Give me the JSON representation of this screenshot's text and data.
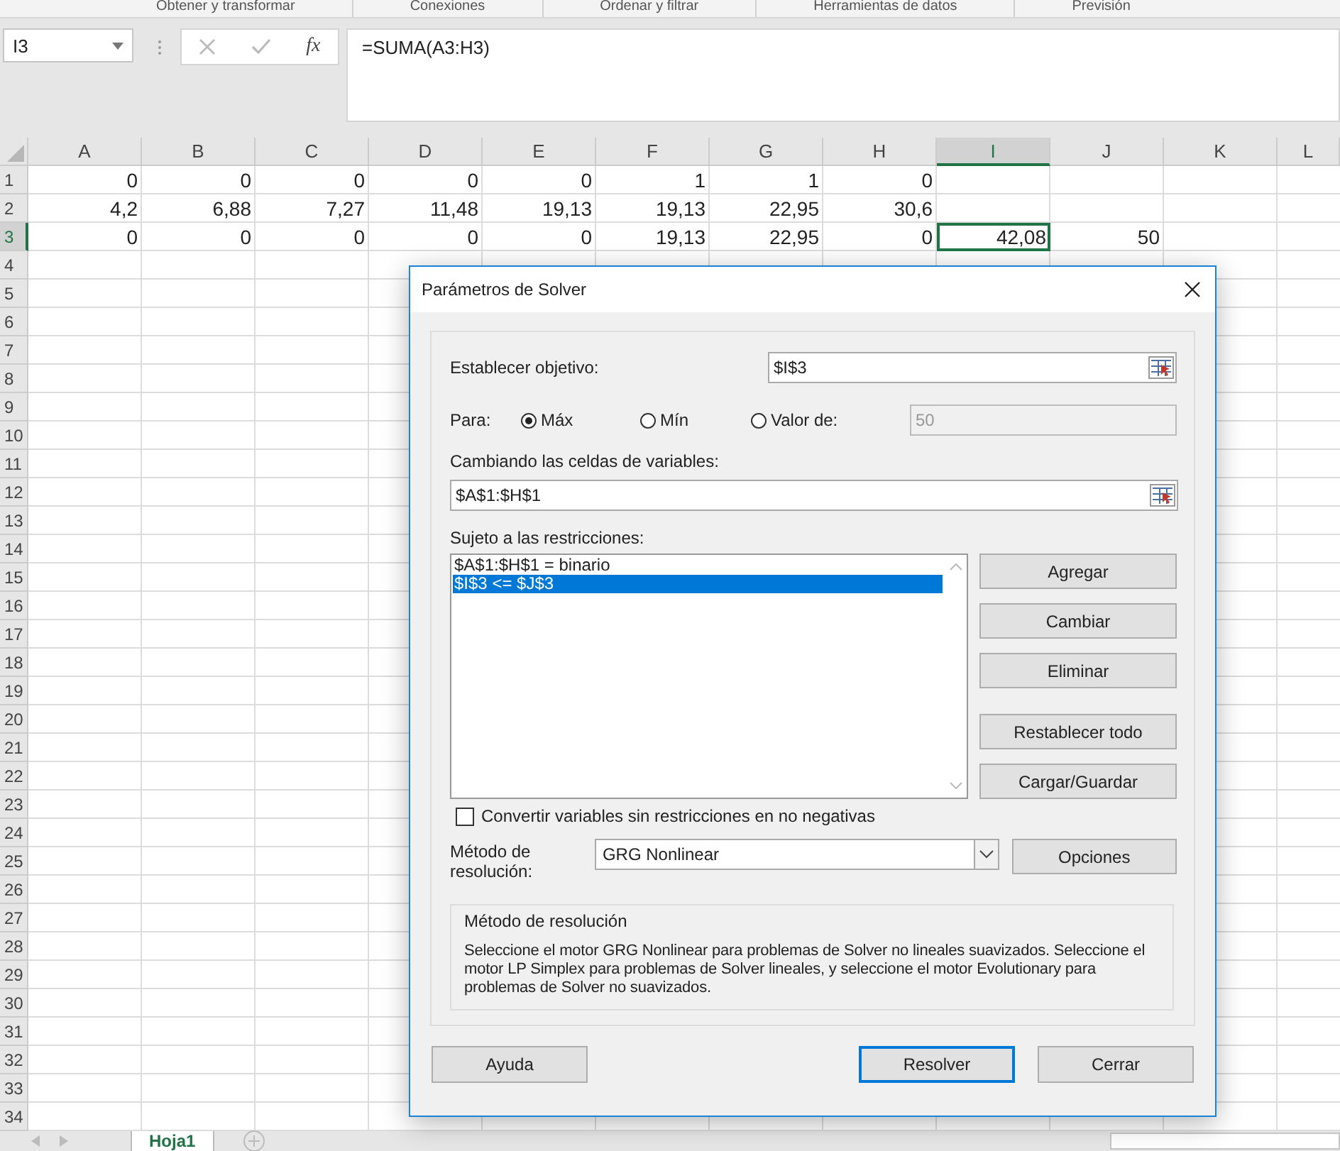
{
  "ribbon_groups": [
    "Obtener y transformar",
    "Conexiones",
    "Ordenar y filtrar",
    "Herramientas de datos",
    "Previsión"
  ],
  "formula_bar": {
    "name_box": "I3",
    "function_label": "fx",
    "formula": "=SUMA(A3:H3)"
  },
  "sheet": {
    "columns": [
      {
        "label": "A",
        "selected": false
      },
      {
        "label": "B",
        "selected": false
      },
      {
        "label": "C",
        "selected": false
      },
      {
        "label": "D",
        "selected": false
      },
      {
        "label": "E",
        "selected": false
      },
      {
        "label": "F",
        "selected": false
      },
      {
        "label": "G",
        "selected": false
      },
      {
        "label": "H",
        "selected": false
      },
      {
        "label": "I",
        "selected": true
      },
      {
        "label": "J",
        "selected": false
      },
      {
        "label": "K",
        "selected": false
      },
      {
        "label": "L",
        "selected": false
      }
    ],
    "rows": [
      {
        "number": "1",
        "selected": false,
        "cells": [
          "0",
          "0",
          "0",
          "0",
          "0",
          "1",
          "1",
          "0"
        ]
      },
      {
        "number": "2",
        "selected": false,
        "cells": [
          "4,2",
          "6,88",
          "7,27",
          "11,48",
          "19,13",
          "19,13",
          "22,95",
          "30,6"
        ]
      },
      {
        "number": "3",
        "selected": true,
        "cells": [
          "0",
          "0",
          "0",
          "0",
          "0",
          "19,13",
          "22,95",
          "0",
          "42,08",
          "50"
        ]
      },
      {
        "number": "4",
        "selected": false
      },
      {
        "number": "5",
        "selected": false
      },
      {
        "number": "6",
        "selected": false
      },
      {
        "number": "7",
        "selected": false
      },
      {
        "number": "8",
        "selected": false
      },
      {
        "number": "9",
        "selected": false
      },
      {
        "number": "10",
        "selected": false
      },
      {
        "number": "11",
        "selected": false
      },
      {
        "number": "12",
        "selected": false
      },
      {
        "number": "13",
        "selected": false
      },
      {
        "number": "14",
        "selected": false
      },
      {
        "number": "15",
        "selected": false
      },
      {
        "number": "16",
        "selected": false
      },
      {
        "number": "17",
        "selected": false
      },
      {
        "number": "18",
        "selected": false
      },
      {
        "number": "19",
        "selected": false
      },
      {
        "number": "20",
        "selected": false
      },
      {
        "number": "21",
        "selected": false
      },
      {
        "number": "22",
        "selected": false
      },
      {
        "number": "23",
        "selected": false
      },
      {
        "number": "24",
        "selected": false
      },
      {
        "number": "25",
        "selected": false
      },
      {
        "number": "26",
        "selected": false
      },
      {
        "number": "27",
        "selected": false
      },
      {
        "number": "28",
        "selected": false
      },
      {
        "number": "29",
        "selected": false
      },
      {
        "number": "30",
        "selected": false
      },
      {
        "number": "31",
        "selected": false
      },
      {
        "number": "32",
        "selected": false
      },
      {
        "number": "33",
        "selected": false
      },
      {
        "number": "34",
        "selected": false
      }
    ]
  },
  "sheet_tabs": [
    {
      "label": "Hoja1",
      "selected": true
    }
  ],
  "dialog": {
    "title": "Parámetros de Solver",
    "objective": {
      "label": "Establecer objetivo:",
      "value": "$I$3"
    },
    "to": {
      "label": "Para:",
      "options": [
        {
          "label": "Máx",
          "selected": true
        },
        {
          "label": "Mín",
          "selected": false
        },
        {
          "label": "Valor de:",
          "selected": false
        }
      ],
      "value_field": {
        "value": "50",
        "disabled": true
      }
    },
    "variables": {
      "label": "Cambiando las celdas de variables:",
      "value": "$A$1:$H$1"
    },
    "constraints": {
      "label": "Sujeto a las restricciones:",
      "items": [
        {
          "text": "$A$1:$H$1 = binario",
          "selected": false
        },
        {
          "text": "$I$3 <= $J$3",
          "selected": true
        }
      ],
      "buttons": [
        {
          "label": "Agregar",
          "gap_before": false
        },
        {
          "label": "Cambiar",
          "gap_before": false
        },
        {
          "label": "Eliminar",
          "gap_before": false
        },
        {
          "label": "Restablecer todo",
          "gap_before": true
        },
        {
          "label": "Cargar/Guardar",
          "gap_before": false
        }
      ]
    },
    "nonnegative": {
      "label": "Convertir variables sin restricciones en no negativas",
      "checked": false
    },
    "method": {
      "label": "Método de resolución:",
      "value": "GRG Nonlinear",
      "options_button": "Opciones"
    },
    "method_group": {
      "title": "Método de resolución",
      "text": "Seleccione el motor GRG Nonlinear para problemas de Solver no lineales suavizados. Seleccione el motor LP Simplex para problemas de Solver lineales, y seleccione el motor Evolutionary para problemas de Solver no suavizados."
    },
    "footer_buttons": [
      {
        "label": "Ayuda",
        "default": false
      },
      {
        "label": "Resolver",
        "default": true
      },
      {
        "label": "Cerrar",
        "default": false
      }
    ]
  }
}
